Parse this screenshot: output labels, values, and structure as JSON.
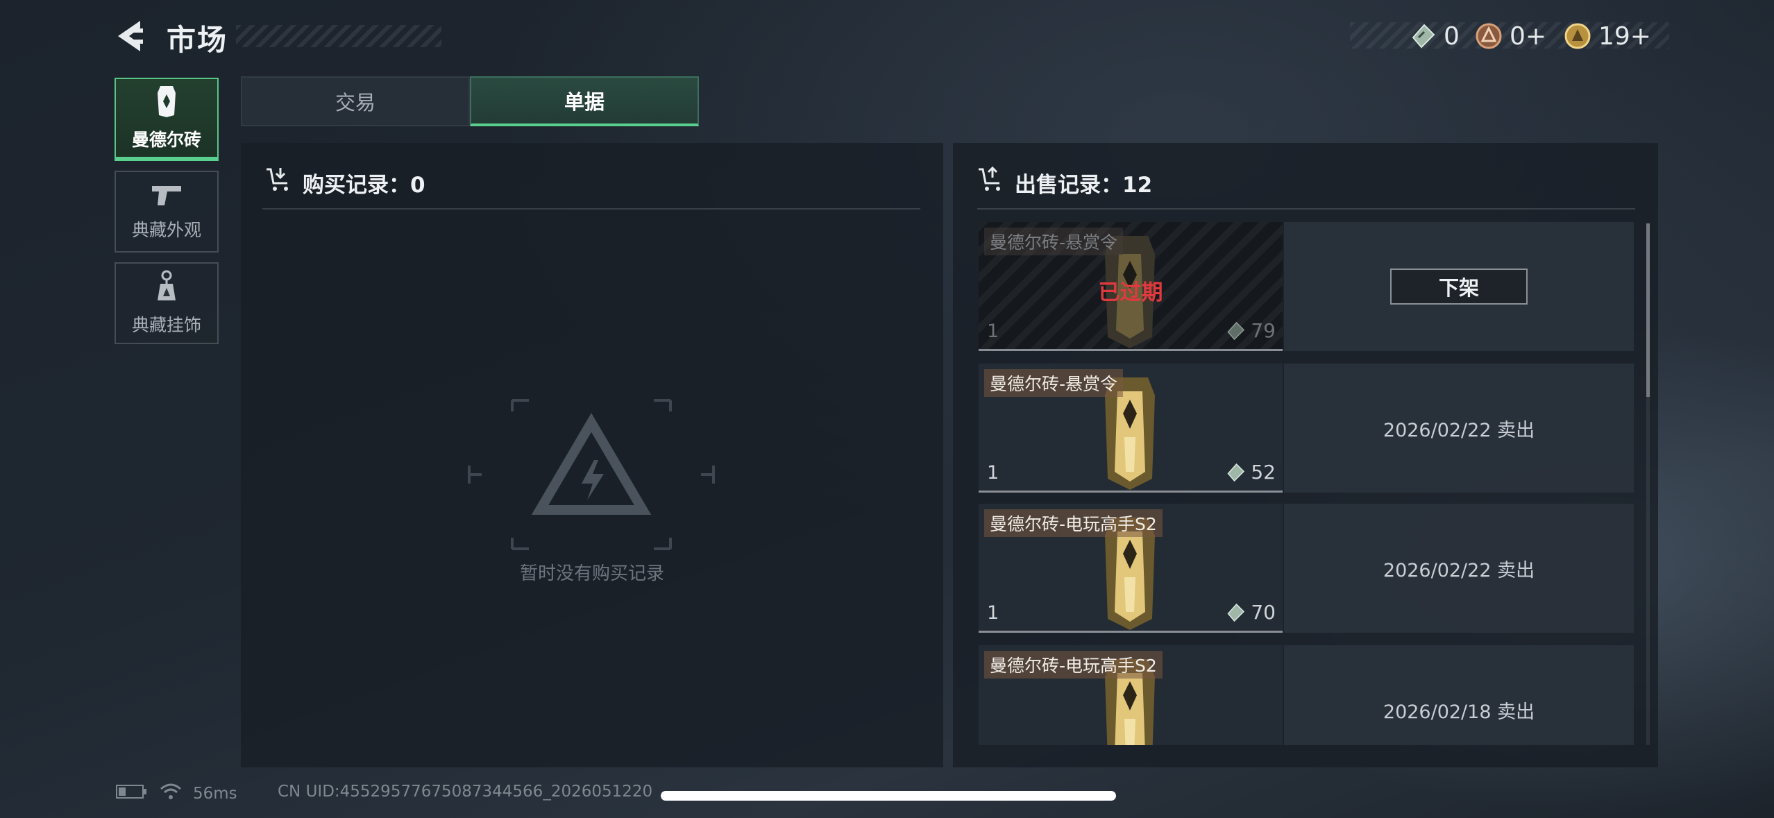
{
  "header": {
    "title": "市场",
    "currencies": [
      {
        "icon": "ticket-icon",
        "value": "0"
      },
      {
        "icon": "bronze-coin-icon",
        "value": "0+"
      },
      {
        "icon": "gold-coin-icon",
        "value": "19+"
      }
    ]
  },
  "sidebar": {
    "items": [
      {
        "label": "曼德尔砖",
        "icon": "mandel-brick-icon",
        "active": true
      },
      {
        "label": "典藏外观",
        "icon": "pistol-icon",
        "active": false
      },
      {
        "label": "典藏挂饰",
        "icon": "charm-icon",
        "active": false
      }
    ]
  },
  "tabs": [
    {
      "label": "交易",
      "active": false
    },
    {
      "label": "单据",
      "active": true
    }
  ],
  "purchase": {
    "title": "购买记录：0",
    "empty_text": "暂时没有购买记录"
  },
  "sales": {
    "title": "出售记录：12",
    "rows": [
      {
        "name": "曼德尔砖-悬赏令",
        "qty": "1",
        "price": "79",
        "state": "已过期",
        "action": "下架"
      },
      {
        "name": "曼德尔砖-悬赏令",
        "qty": "1",
        "price": "52",
        "status": "2026/02/22 卖出"
      },
      {
        "name": "曼德尔砖-电玩高手S2",
        "qty": "1",
        "price": "70",
        "status": "2026/02/22 卖出"
      },
      {
        "name": "曼德尔砖-电玩高手S2",
        "status": "2026/02/18 卖出"
      }
    ]
  },
  "footer": {
    "ping": "56ms",
    "uid": "CN UID:4552957767508734456​6_2026051220"
  },
  "colors": {
    "accent_green": "#5ad08f",
    "expired_red": "#e0393e"
  }
}
